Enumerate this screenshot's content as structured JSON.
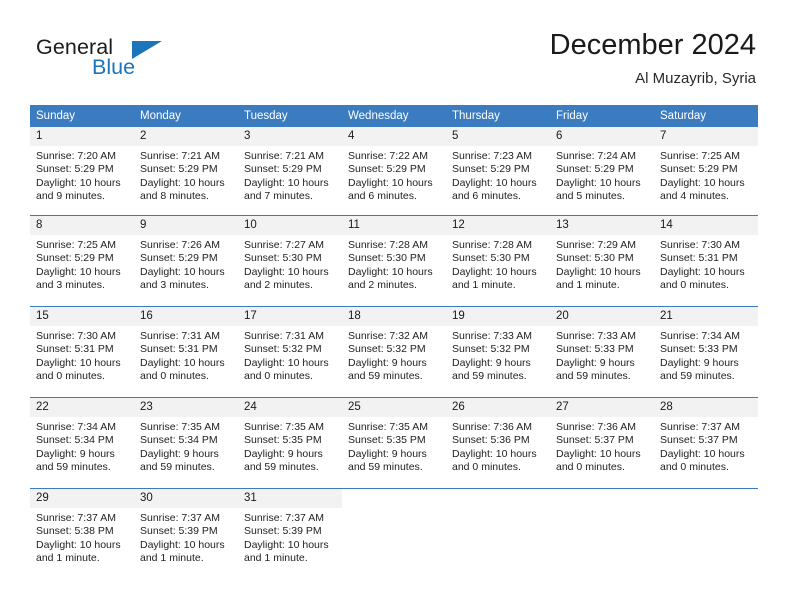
{
  "brand": {
    "word_one": "General",
    "word_two": "Blue",
    "flag_icon": "triangle-flag-icon"
  },
  "header": {
    "title": "December 2024",
    "subtitle": "Al Muzayrib, Syria"
  },
  "weekday_headers": [
    "Sunday",
    "Monday",
    "Tuesday",
    "Wednesday",
    "Thursday",
    "Friday",
    "Saturday"
  ],
  "colors": {
    "header_blue": "#3b7cc0",
    "brand_blue": "#1b75bb",
    "daynum_background": "#f2f2f2",
    "text": "#1a1a1a"
  },
  "weeks": [
    [
      {
        "day": "1",
        "sunrise": "Sunrise: 7:20 AM",
        "sunset": "Sunset: 5:29 PM",
        "daylight_line1": "Daylight: 10 hours",
        "daylight_line2": "and 9 minutes."
      },
      {
        "day": "2",
        "sunrise": "Sunrise: 7:21 AM",
        "sunset": "Sunset: 5:29 PM",
        "daylight_line1": "Daylight: 10 hours",
        "daylight_line2": "and 8 minutes."
      },
      {
        "day": "3",
        "sunrise": "Sunrise: 7:21 AM",
        "sunset": "Sunset: 5:29 PM",
        "daylight_line1": "Daylight: 10 hours",
        "daylight_line2": "and 7 minutes."
      },
      {
        "day": "4",
        "sunrise": "Sunrise: 7:22 AM",
        "sunset": "Sunset: 5:29 PM",
        "daylight_line1": "Daylight: 10 hours",
        "daylight_line2": "and 6 minutes."
      },
      {
        "day": "5",
        "sunrise": "Sunrise: 7:23 AM",
        "sunset": "Sunset: 5:29 PM",
        "daylight_line1": "Daylight: 10 hours",
        "daylight_line2": "and 6 minutes."
      },
      {
        "day": "6",
        "sunrise": "Sunrise: 7:24 AM",
        "sunset": "Sunset: 5:29 PM",
        "daylight_line1": "Daylight: 10 hours",
        "daylight_line2": "and 5 minutes."
      },
      {
        "day": "7",
        "sunrise": "Sunrise: 7:25 AM",
        "sunset": "Sunset: 5:29 PM",
        "daylight_line1": "Daylight: 10 hours",
        "daylight_line2": "and 4 minutes."
      }
    ],
    [
      {
        "day": "8",
        "sunrise": "Sunrise: 7:25 AM",
        "sunset": "Sunset: 5:29 PM",
        "daylight_line1": "Daylight: 10 hours",
        "daylight_line2": "and 3 minutes."
      },
      {
        "day": "9",
        "sunrise": "Sunrise: 7:26 AM",
        "sunset": "Sunset: 5:29 PM",
        "daylight_line1": "Daylight: 10 hours",
        "daylight_line2": "and 3 minutes."
      },
      {
        "day": "10",
        "sunrise": "Sunrise: 7:27 AM",
        "sunset": "Sunset: 5:30 PM",
        "daylight_line1": "Daylight: 10 hours",
        "daylight_line2": "and 2 minutes."
      },
      {
        "day": "11",
        "sunrise": "Sunrise: 7:28 AM",
        "sunset": "Sunset: 5:30 PM",
        "daylight_line1": "Daylight: 10 hours",
        "daylight_line2": "and 2 minutes."
      },
      {
        "day": "12",
        "sunrise": "Sunrise: 7:28 AM",
        "sunset": "Sunset: 5:30 PM",
        "daylight_line1": "Daylight: 10 hours",
        "daylight_line2": "and 1 minute."
      },
      {
        "day": "13",
        "sunrise": "Sunrise: 7:29 AM",
        "sunset": "Sunset: 5:30 PM",
        "daylight_line1": "Daylight: 10 hours",
        "daylight_line2": "and 1 minute."
      },
      {
        "day": "14",
        "sunrise": "Sunrise: 7:30 AM",
        "sunset": "Sunset: 5:31 PM",
        "daylight_line1": "Daylight: 10 hours",
        "daylight_line2": "and 0 minutes."
      }
    ],
    [
      {
        "day": "15",
        "sunrise": "Sunrise: 7:30 AM",
        "sunset": "Sunset: 5:31 PM",
        "daylight_line1": "Daylight: 10 hours",
        "daylight_line2": "and 0 minutes."
      },
      {
        "day": "16",
        "sunrise": "Sunrise: 7:31 AM",
        "sunset": "Sunset: 5:31 PM",
        "daylight_line1": "Daylight: 10 hours",
        "daylight_line2": "and 0 minutes."
      },
      {
        "day": "17",
        "sunrise": "Sunrise: 7:31 AM",
        "sunset": "Sunset: 5:32 PM",
        "daylight_line1": "Daylight: 10 hours",
        "daylight_line2": "and 0 minutes."
      },
      {
        "day": "18",
        "sunrise": "Sunrise: 7:32 AM",
        "sunset": "Sunset: 5:32 PM",
        "daylight_line1": "Daylight: 9 hours",
        "daylight_line2": "and 59 minutes."
      },
      {
        "day": "19",
        "sunrise": "Sunrise: 7:33 AM",
        "sunset": "Sunset: 5:32 PM",
        "daylight_line1": "Daylight: 9 hours",
        "daylight_line2": "and 59 minutes."
      },
      {
        "day": "20",
        "sunrise": "Sunrise: 7:33 AM",
        "sunset": "Sunset: 5:33 PM",
        "daylight_line1": "Daylight: 9 hours",
        "daylight_line2": "and 59 minutes."
      },
      {
        "day": "21",
        "sunrise": "Sunrise: 7:34 AM",
        "sunset": "Sunset: 5:33 PM",
        "daylight_line1": "Daylight: 9 hours",
        "daylight_line2": "and 59 minutes."
      }
    ],
    [
      {
        "day": "22",
        "sunrise": "Sunrise: 7:34 AM",
        "sunset": "Sunset: 5:34 PM",
        "daylight_line1": "Daylight: 9 hours",
        "daylight_line2": "and 59 minutes."
      },
      {
        "day": "23",
        "sunrise": "Sunrise: 7:35 AM",
        "sunset": "Sunset: 5:34 PM",
        "daylight_line1": "Daylight: 9 hours",
        "daylight_line2": "and 59 minutes."
      },
      {
        "day": "24",
        "sunrise": "Sunrise: 7:35 AM",
        "sunset": "Sunset: 5:35 PM",
        "daylight_line1": "Daylight: 9 hours",
        "daylight_line2": "and 59 minutes."
      },
      {
        "day": "25",
        "sunrise": "Sunrise: 7:35 AM",
        "sunset": "Sunset: 5:35 PM",
        "daylight_line1": "Daylight: 9 hours",
        "daylight_line2": "and 59 minutes."
      },
      {
        "day": "26",
        "sunrise": "Sunrise: 7:36 AM",
        "sunset": "Sunset: 5:36 PM",
        "daylight_line1": "Daylight: 10 hours",
        "daylight_line2": "and 0 minutes."
      },
      {
        "day": "27",
        "sunrise": "Sunrise: 7:36 AM",
        "sunset": "Sunset: 5:37 PM",
        "daylight_line1": "Daylight: 10 hours",
        "daylight_line2": "and 0 minutes."
      },
      {
        "day": "28",
        "sunrise": "Sunrise: 7:37 AM",
        "sunset": "Sunset: 5:37 PM",
        "daylight_line1": "Daylight: 10 hours",
        "daylight_line2": "and 0 minutes."
      }
    ],
    [
      {
        "day": "29",
        "sunrise": "Sunrise: 7:37 AM",
        "sunset": "Sunset: 5:38 PM",
        "daylight_line1": "Daylight: 10 hours",
        "daylight_line2": "and 1 minute."
      },
      {
        "day": "30",
        "sunrise": "Sunrise: 7:37 AM",
        "sunset": "Sunset: 5:39 PM",
        "daylight_line1": "Daylight: 10 hours",
        "daylight_line2": "and 1 minute."
      },
      {
        "day": "31",
        "sunrise": "Sunrise: 7:37 AM",
        "sunset": "Sunset: 5:39 PM",
        "daylight_line1": "Daylight: 10 hours",
        "daylight_line2": "and 1 minute."
      },
      {
        "day": "",
        "sunrise": "",
        "sunset": "",
        "daylight_line1": "",
        "daylight_line2": ""
      },
      {
        "day": "",
        "sunrise": "",
        "sunset": "",
        "daylight_line1": "",
        "daylight_line2": ""
      },
      {
        "day": "",
        "sunrise": "",
        "sunset": "",
        "daylight_line1": "",
        "daylight_line2": ""
      },
      {
        "day": "",
        "sunrise": "",
        "sunset": "",
        "daylight_line1": "",
        "daylight_line2": ""
      }
    ]
  ]
}
